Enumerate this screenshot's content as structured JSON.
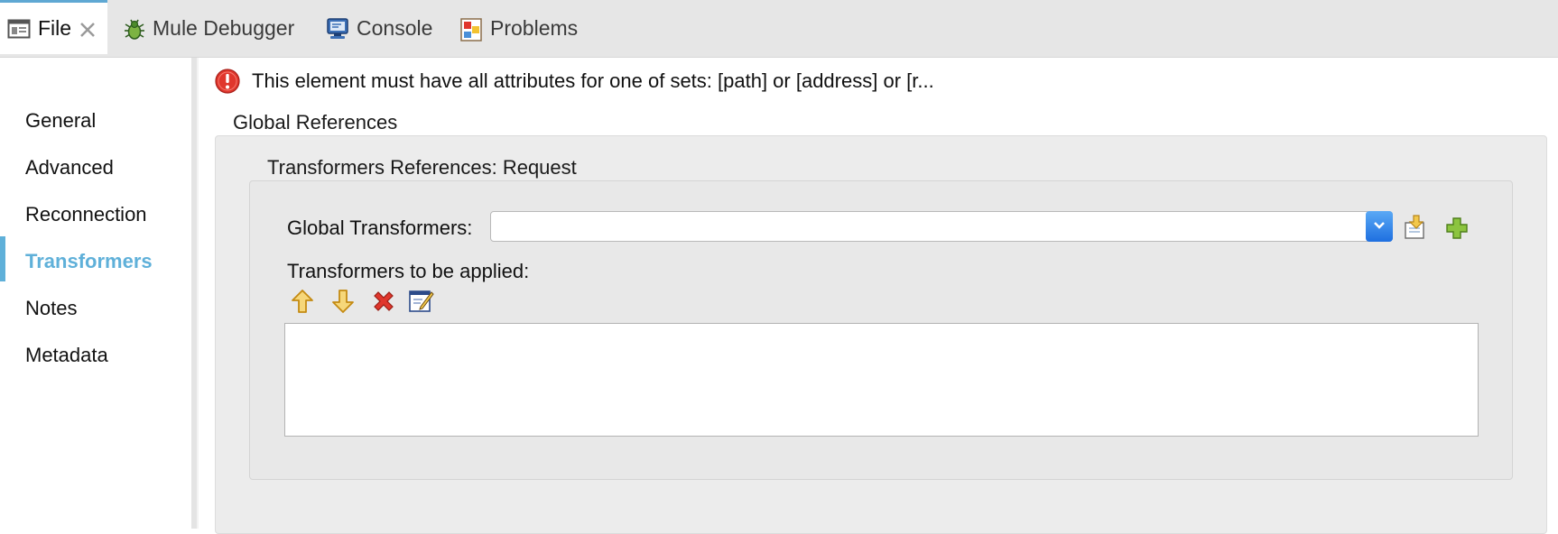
{
  "tabs": [
    {
      "label": "File",
      "icon": "file-icon",
      "active": true,
      "closable": true
    },
    {
      "label": "Mule Debugger",
      "icon": "bug-icon"
    },
    {
      "label": "Console",
      "icon": "console-icon"
    },
    {
      "label": "Problems",
      "icon": "problems-icon"
    }
  ],
  "sidebar": {
    "items": [
      {
        "label": "General"
      },
      {
        "label": "Advanced"
      },
      {
        "label": "Reconnection"
      },
      {
        "label": "Transformers",
        "active": true
      },
      {
        "label": "Notes"
      },
      {
        "label": "Metadata"
      }
    ]
  },
  "error": {
    "icon": "error-icon",
    "message": "This element must have all attributes for one of sets: [path] or [address] or [r..."
  },
  "global_references": {
    "title": "Global References",
    "request": {
      "title": "Transformers References: Request",
      "global_transformers_label": "Global Transformers:",
      "global_transformers_value": "",
      "to_be_applied_label": "Transformers to be applied:"
    }
  },
  "colors": {
    "accent": "#5fb0d9",
    "error": "#e0362c",
    "combo_button": "#2d7fe8"
  }
}
